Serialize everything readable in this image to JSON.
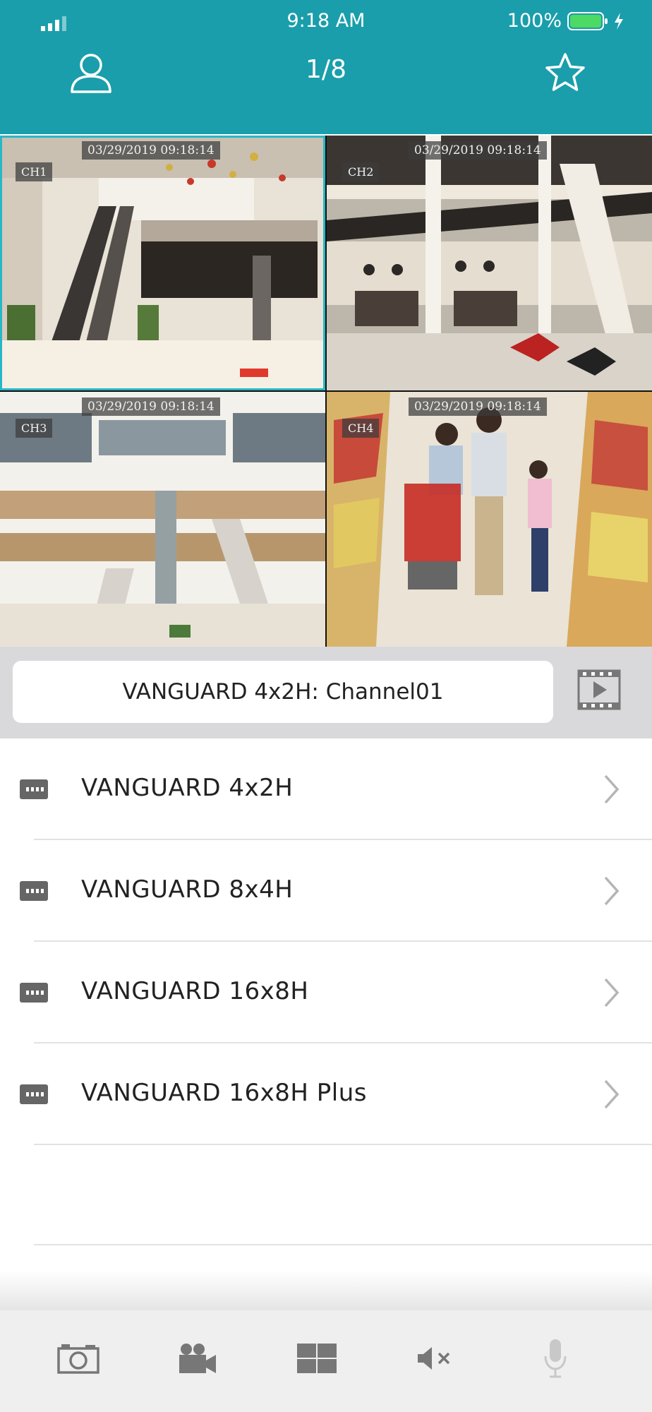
{
  "status_bar": {
    "time": "9:18 AM",
    "battery_percent": "100%"
  },
  "header": {
    "page_indicator": "1/8",
    "user_icon": "user-icon",
    "favorite_icon": "star-icon",
    "background_color": "#1a9eab"
  },
  "video_grid": {
    "selected_channel": "CH1",
    "cells": [
      {
        "channel": "CH1",
        "timestamp": "03/29/2019  09:18:14"
      },
      {
        "channel": "CH2",
        "timestamp": "03/29/2019  09:18:14"
      },
      {
        "channel": "CH3",
        "timestamp": "03/29/2019  09:18:14"
      },
      {
        "channel": "CH4",
        "timestamp": "03/29/2019  09:18:14"
      }
    ]
  },
  "channel_bar": {
    "current_channel": "VANGUARD 4x2H: Channel01",
    "playback_icon": "playback-icon"
  },
  "devices": [
    {
      "name": "VANGUARD 4x2H"
    },
    {
      "name": "VANGUARD 8x4H"
    },
    {
      "name": "VANGUARD 16x8H"
    },
    {
      "name": "VANGUARD 16x8H Plus"
    }
  ],
  "toolbar": {
    "icons": [
      "camera-icon",
      "video-record-icon",
      "grid-layout-icon",
      "mute-icon",
      "microphone-icon"
    ]
  }
}
